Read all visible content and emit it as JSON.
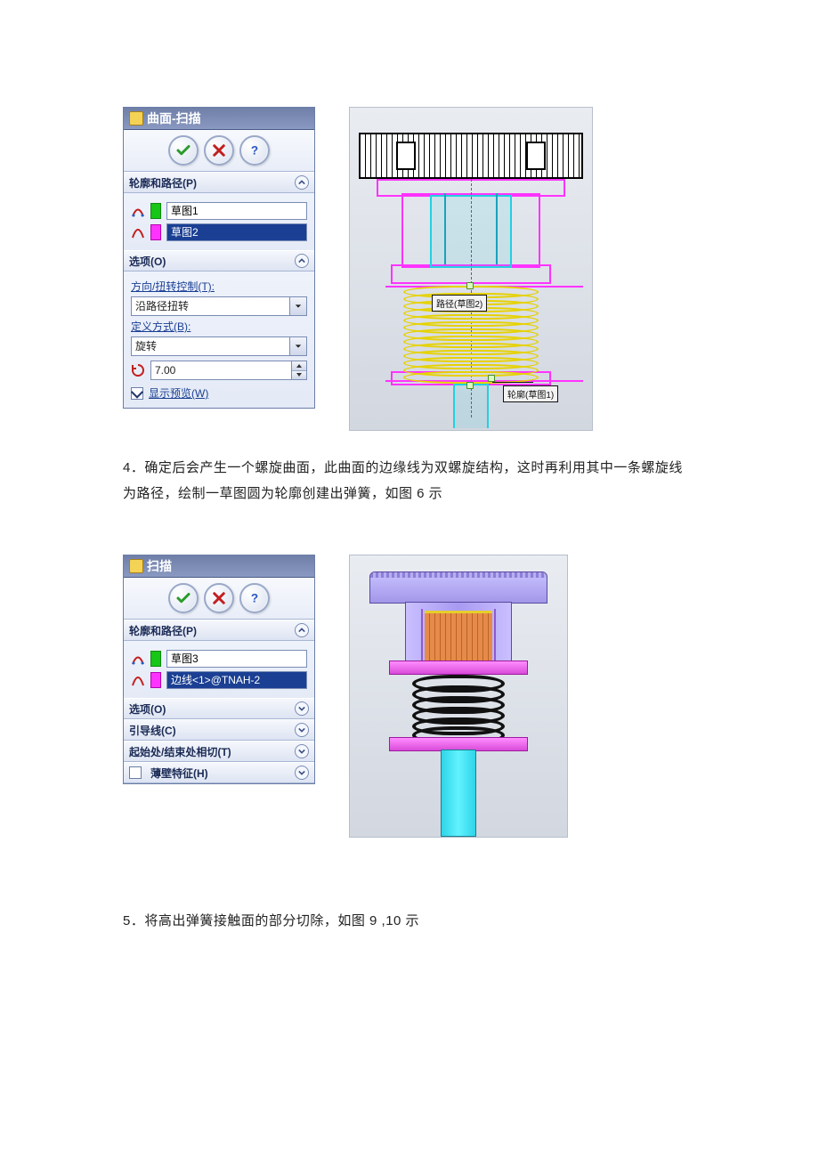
{
  "panel1": {
    "title": "曲面-扫描",
    "section_profile_path": "轮廓和路径(P)",
    "profile_value": "草图1",
    "path_value": "草图2",
    "section_options": "选项(O)",
    "dir_twist_label": "方向/扭转控制(T):",
    "dir_twist_value": "沿路径扭转",
    "define_by_label": "定义方式(B):",
    "define_by_value": "旋转",
    "turns_value": "7.00",
    "show_preview_label": "显示预览(W)"
  },
  "cad1": {
    "path_tag": "路径(草图2)",
    "profile_tag": "轮廓(草图1)"
  },
  "para4": "4．确定后会产生一个螺旋曲面，此曲面的边缘线为双螺旋结构，这时再利用其中一条螺旋线为路径，绘制一草图圆为轮廓创建出弹簧，如图 6 示",
  "panel2": {
    "title": "扫描",
    "section_profile_path": "轮廓和路径(P)",
    "profile_value": "草图3",
    "path_value": "边线<1>@TNAH-2",
    "section_options": "选项(O)",
    "section_guides": "引导线(C)",
    "section_tangency": "起始处/结束处相切(T)",
    "section_thin": "薄壁特征(H)"
  },
  "para5": "5．将高出弹簧接触面的部分切除，如图 9 ,10 示"
}
